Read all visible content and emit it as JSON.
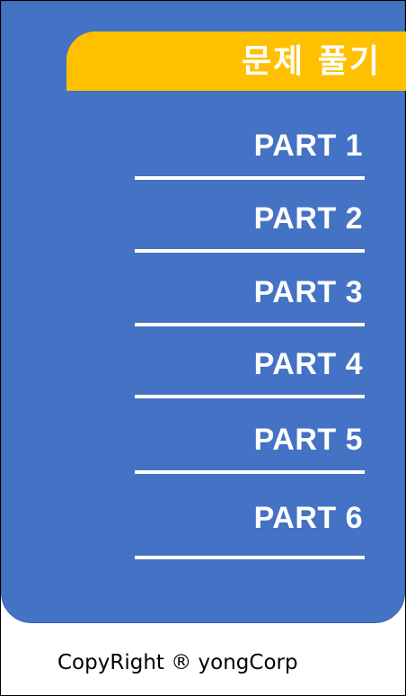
{
  "title": "문제 풀기",
  "menu": {
    "items": [
      {
        "label": "PART 1"
      },
      {
        "label": "PART 2"
      },
      {
        "label": "PART 3"
      },
      {
        "label": "PART 4"
      },
      {
        "label": "PART 5"
      },
      {
        "label": "PART 6"
      }
    ]
  },
  "footer": "CopyRight ® yongCorp",
  "colors": {
    "panel": "#4472C4",
    "title_tab": "#FFC000",
    "text": "#FFFFFF"
  }
}
